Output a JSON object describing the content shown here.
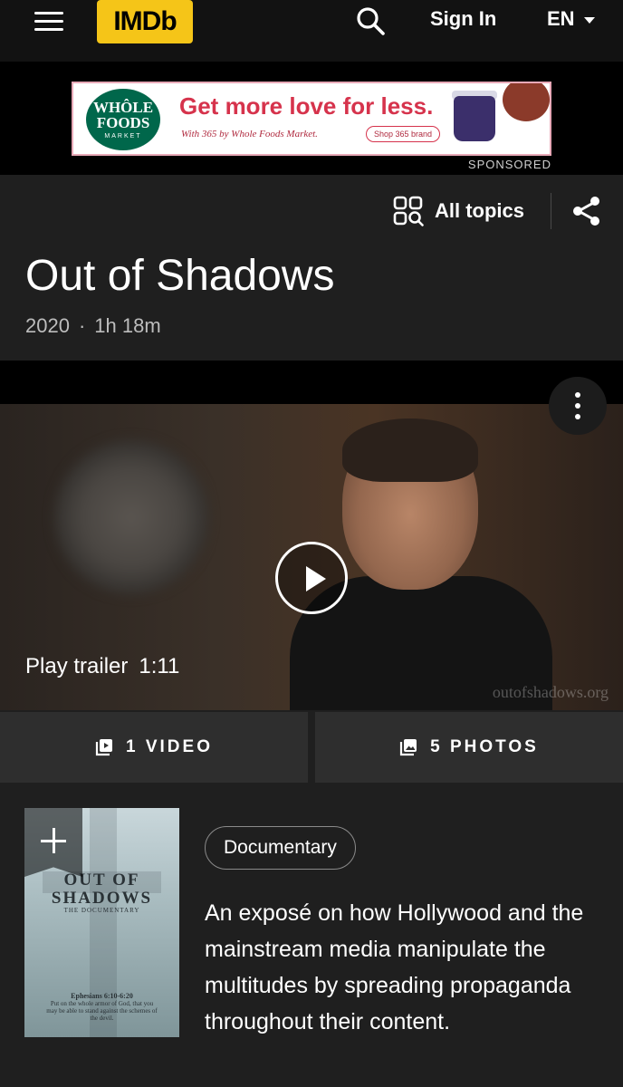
{
  "nav": {
    "logo_text": "IMDb",
    "sign_in": "Sign In",
    "language": "EN"
  },
  "ad": {
    "brand_line1": "WHÔLE",
    "brand_line2": "FOODS",
    "brand_line3": "MARKET",
    "headline": "Get more love for less.",
    "subline": "With 365 by Whole Foods Market.",
    "cta": "Shop 365 brand",
    "sponsored_label": "SPONSORED"
  },
  "title_section": {
    "all_topics": "All topics",
    "title": "Out of Shadows",
    "year": "2020",
    "separator": "·",
    "runtime": "1h 18m"
  },
  "video": {
    "play_label": "Play trailer",
    "duration": "1:11",
    "watermark": "outofshadows.org"
  },
  "media_buttons": {
    "videos": "1 VIDEO",
    "photos": "5 PHOTOS"
  },
  "poster": {
    "title_line1": "OUT OF",
    "title_line2": "SHADOWS",
    "subtitle": "THE DOCUMENTARY",
    "verse_ref": "Ephesians 6:10-6:20",
    "verse_text": "Put on the whole armor of God, that you may be able to stand against the schemes of the devil."
  },
  "details": {
    "genre": "Documentary",
    "plot": "An exposé on how Hollywood and the mainstream media manipulate the multitudes by spreading propaganda throughout their content."
  },
  "colors": {
    "imdb_yellow": "#f5c518",
    "background": "#1f1f1f",
    "nav_background": "#121212"
  }
}
